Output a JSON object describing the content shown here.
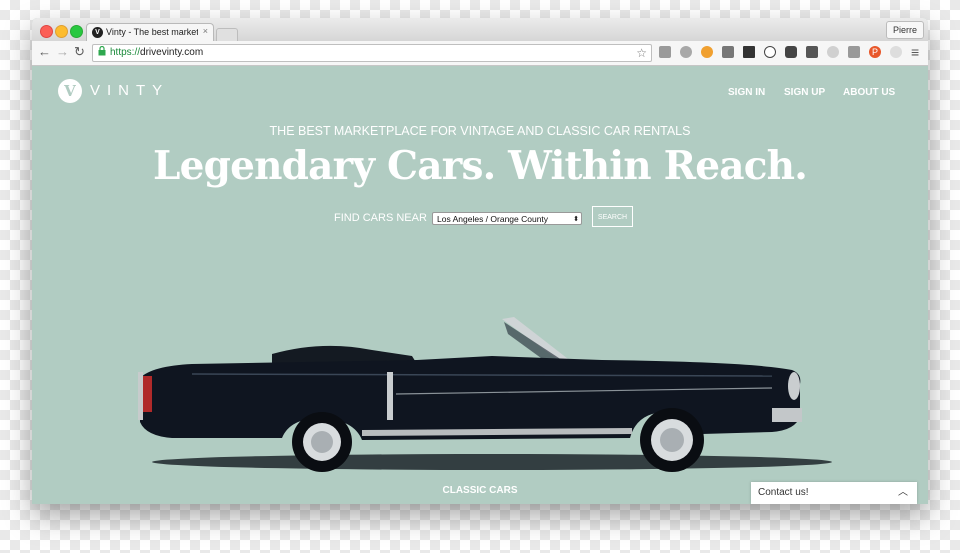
{
  "browser": {
    "tab_title": "Vinty - The best marketplace",
    "tab_close": "×",
    "profile": "Pierre",
    "url_scheme": "https://",
    "url_host": "drivevinty.com",
    "back": "←",
    "forward": "→",
    "reload": "↻",
    "bookmark": "☆",
    "menu": "≡"
  },
  "site": {
    "logo_letter": "V",
    "logo_text": "VINTY",
    "nav": {
      "sign_in": "SIGN IN",
      "sign_up": "SIGN UP",
      "about": "ABOUT US"
    },
    "tagline": "THE BEST MARKETPLACE FOR VINTAGE AND CLASSIC CAR RENTALS",
    "headline": "Legendary Cars. Within Reach.",
    "find_label": "FIND CARS NEAR",
    "location_value": "Los Angeles / Orange County",
    "search_label": "SEARCH",
    "section_label": "CLASSIC CARS",
    "contact_label": "Contact us!"
  },
  "colors": {
    "page_bg": "#b1ccc2",
    "car_body": "#0f1520"
  }
}
